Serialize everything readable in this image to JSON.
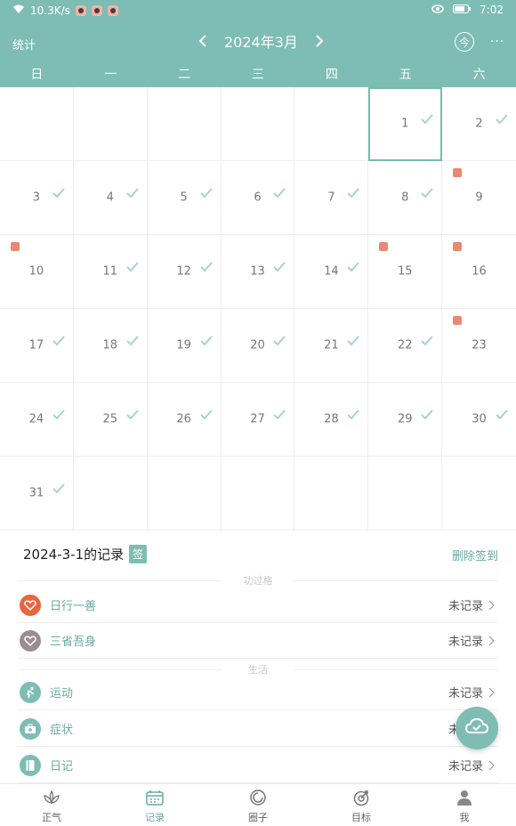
{
  "status_bar": {
    "speed": "10.3K/s",
    "time": "7:02"
  },
  "toolbar": {
    "stats_label": "统计",
    "month_title": "2024年3月",
    "today_label": "今",
    "more_label": "···"
  },
  "weekdays": [
    "日",
    "一",
    "二",
    "三",
    "四",
    "五",
    "六"
  ],
  "calendar": {
    "cells": [
      {
        "day": "",
        "check": false,
        "marker": false
      },
      {
        "day": "",
        "check": false,
        "marker": false
      },
      {
        "day": "",
        "check": false,
        "marker": false
      },
      {
        "day": "",
        "check": false,
        "marker": false
      },
      {
        "day": "",
        "check": false,
        "marker": false
      },
      {
        "day": "1",
        "check": true,
        "marker": false,
        "selected": true
      },
      {
        "day": "2",
        "check": true,
        "marker": false
      },
      {
        "day": "3",
        "check": true,
        "marker": false
      },
      {
        "day": "4",
        "check": true,
        "marker": false
      },
      {
        "day": "5",
        "check": true,
        "marker": false
      },
      {
        "day": "6",
        "check": true,
        "marker": false
      },
      {
        "day": "7",
        "check": true,
        "marker": false
      },
      {
        "day": "8",
        "check": true,
        "marker": false
      },
      {
        "day": "9",
        "check": false,
        "marker": true
      },
      {
        "day": "10",
        "check": false,
        "marker": true
      },
      {
        "day": "11",
        "check": true,
        "marker": false
      },
      {
        "day": "12",
        "check": true,
        "marker": false
      },
      {
        "day": "13",
        "check": true,
        "marker": false
      },
      {
        "day": "14",
        "check": true,
        "marker": false
      },
      {
        "day": "15",
        "check": false,
        "marker": true
      },
      {
        "day": "16",
        "check": false,
        "marker": true
      },
      {
        "day": "17",
        "check": true,
        "marker": false
      },
      {
        "day": "18",
        "check": true,
        "marker": false
      },
      {
        "day": "19",
        "check": true,
        "marker": false
      },
      {
        "day": "20",
        "check": true,
        "marker": false
      },
      {
        "day": "21",
        "check": true,
        "marker": false
      },
      {
        "day": "22",
        "check": true,
        "marker": false
      },
      {
        "day": "23",
        "check": false,
        "marker": true
      },
      {
        "day": "24",
        "check": true,
        "marker": false
      },
      {
        "day": "25",
        "check": true,
        "marker": false
      },
      {
        "day": "26",
        "check": true,
        "marker": false
      },
      {
        "day": "27",
        "check": true,
        "marker": false
      },
      {
        "day": "28",
        "check": true,
        "marker": false
      },
      {
        "day": "29",
        "check": true,
        "marker": false
      },
      {
        "day": "30",
        "check": true,
        "marker": false
      },
      {
        "day": "31",
        "check": true,
        "marker": false
      },
      {
        "day": "",
        "check": false,
        "marker": false
      },
      {
        "day": "",
        "check": false,
        "marker": false
      },
      {
        "day": "",
        "check": false,
        "marker": false
      },
      {
        "day": "",
        "check": false,
        "marker": false
      },
      {
        "day": "",
        "check": false,
        "marker": false
      },
      {
        "day": "",
        "check": false,
        "marker": false
      }
    ]
  },
  "records": {
    "title": "2024-3-1的记录",
    "sign_badge": "签",
    "delete_label": "删除签到",
    "sections": [
      {
        "label": "功过格",
        "items": [
          {
            "name": "日行一善",
            "status": "未记录",
            "icon": "heart-icon",
            "color": "#e8653f"
          },
          {
            "name": "三省吾身",
            "status": "未记录",
            "icon": "heart-outline-icon",
            "color": "#9b8e93"
          }
        ]
      },
      {
        "label": "生活",
        "items": [
          {
            "name": "运动",
            "status": "未记录",
            "icon": "run-icon",
            "color": "#7ebdb4"
          },
          {
            "name": "症状",
            "status": "未记录",
            "icon": "medical-kit-icon",
            "color": "#7ebdb4"
          },
          {
            "name": "日记",
            "status": "未记录",
            "icon": "diary-icon",
            "color": "#7ebdb4"
          }
        ]
      }
    ]
  },
  "bottom_nav": [
    {
      "label": "正气",
      "icon": "lotus-icon",
      "active": false
    },
    {
      "label": "记录",
      "icon": "calendar-icon",
      "active": true
    },
    {
      "label": "圈子",
      "icon": "circle-icon",
      "active": false
    },
    {
      "label": "目标",
      "icon": "target-icon",
      "active": false
    },
    {
      "label": "我",
      "icon": "person-icon",
      "active": false
    }
  ],
  "colors": {
    "primary": "#7ebdb4",
    "accent_text": "#6aa9a2",
    "marker": "#e8836a"
  }
}
